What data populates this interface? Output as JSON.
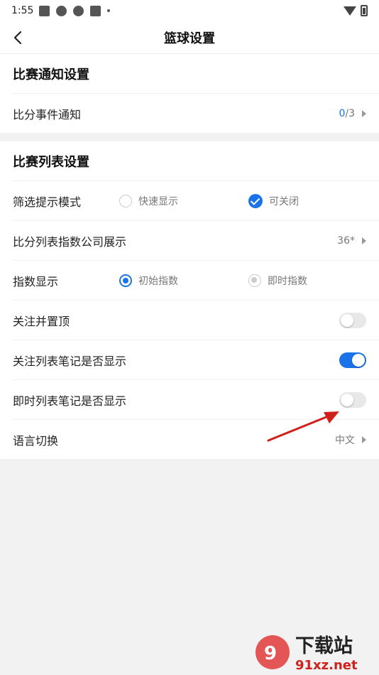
{
  "status_bar": {
    "time": "1:55"
  },
  "nav": {
    "title": "篮球设置"
  },
  "match_notify": {
    "header": "比赛通知设置",
    "score_event": {
      "label": "比分事件通知",
      "count": "0",
      "total": "/3"
    }
  },
  "match_list": {
    "header": "比赛列表设置",
    "filter_mode": {
      "label": "筛选提示模式",
      "opt1": "快速显示",
      "opt2": "可关闭"
    },
    "company_display": {
      "label": "比分列表指数公司展示",
      "value": "36*"
    },
    "index_display": {
      "label": "指数显示",
      "opt1": "初始指数",
      "opt2": "即时指数"
    },
    "follow_top": {
      "label": "关注并置顶",
      "on": false
    },
    "follow_notes": {
      "label": "关注列表笔记是否显示",
      "on": true
    },
    "live_notes": {
      "label": "即时列表笔记是否显示",
      "on": false
    },
    "language": {
      "label": "语言切换",
      "value": "中文"
    }
  },
  "watermark": {
    "brand": "下载站",
    "domain": "91xz.net"
  },
  "colors": {
    "accent": "#1a73e8",
    "annotation": "#d0201c"
  }
}
